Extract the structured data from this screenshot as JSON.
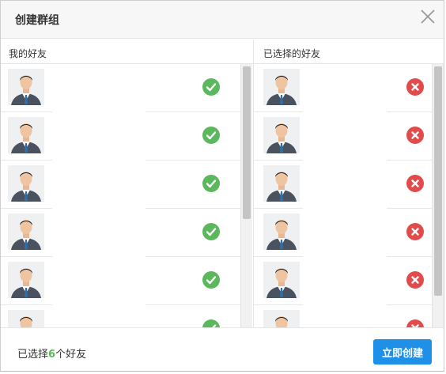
{
  "dialog": {
    "title": "创建群组",
    "close_icon": "close-icon"
  },
  "left_panel": {
    "header": "我的好友",
    "friends": [
      {
        "avatar_icon": "avatar-icon",
        "status_icon": "check-circle-icon"
      },
      {
        "avatar_icon": "avatar-icon",
        "status_icon": "check-circle-icon"
      },
      {
        "avatar_icon": "avatar-icon",
        "status_icon": "check-circle-icon"
      },
      {
        "avatar_icon": "avatar-icon",
        "status_icon": "check-circle-icon"
      },
      {
        "avatar_icon": "avatar-icon",
        "status_icon": "check-circle-icon"
      },
      {
        "avatar_icon": "avatar-icon",
        "status_icon": "check-circle-icon"
      }
    ]
  },
  "right_panel": {
    "header": "已选择的好友",
    "selected": [
      {
        "avatar_icon": "avatar-icon",
        "remove_icon": "remove-circle-icon"
      },
      {
        "avatar_icon": "avatar-icon",
        "remove_icon": "remove-circle-icon"
      },
      {
        "avatar_icon": "avatar-icon",
        "remove_icon": "remove-circle-icon"
      },
      {
        "avatar_icon": "avatar-icon",
        "remove_icon": "remove-circle-icon"
      },
      {
        "avatar_icon": "avatar-icon",
        "remove_icon": "remove-circle-icon"
      },
      {
        "avatar_icon": "avatar-icon",
        "remove_icon": "remove-circle-icon"
      }
    ]
  },
  "footer": {
    "summary_prefix": "已选择",
    "selected_count": "6",
    "summary_suffix": "个好友",
    "create_button": "立即创建"
  },
  "colors": {
    "check": "#5cb85c",
    "remove": "#e24b4b",
    "primary_button": "#1e90e8",
    "count": "#5cb85c"
  }
}
